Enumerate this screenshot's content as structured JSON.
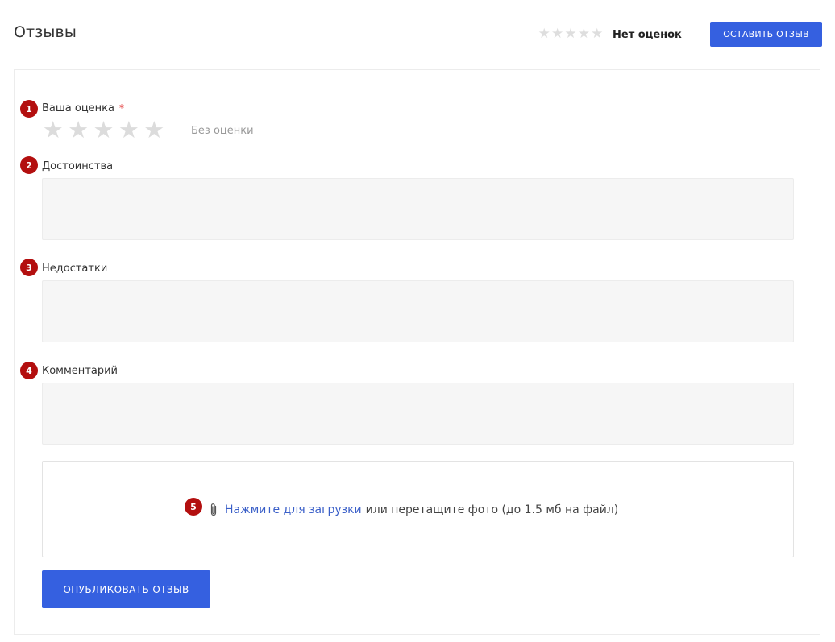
{
  "header": {
    "title": "Отзывы",
    "summary_stars": [
      "★",
      "★",
      "★",
      "★",
      "★"
    ],
    "summary_text": "Нет оценок",
    "leave_review_label": "ОСТАВИТЬ ОТЗЫВ"
  },
  "form": {
    "rating": {
      "badge": "1",
      "label": "Ваша оценка",
      "required_mark": "*",
      "stars": [
        "★",
        "★",
        "★",
        "★",
        "★"
      ],
      "value": 0,
      "max": 5,
      "dash": "—",
      "empty_text": "Без оценки"
    },
    "pros": {
      "badge": "2",
      "label": "Достоинства",
      "value": "",
      "placeholder": ""
    },
    "cons": {
      "badge": "3",
      "label": "Недостатки",
      "value": "",
      "placeholder": ""
    },
    "comment": {
      "badge": "4",
      "label": "Комментарий",
      "value": "",
      "placeholder": ""
    },
    "upload": {
      "badge": "5",
      "link_text": "Нажмите для загрузки",
      "rest_text": "или перетащите фото (до 1.5 мб на файл)"
    },
    "publish_label": "ОПУБЛИКОВАТЬ ОТЗЫВ"
  },
  "colors": {
    "accent": "#3560e0",
    "badge": "#b30f0f",
    "star_empty": "#dcdcdc",
    "link": "#3a5fc8",
    "field_bg": "#f6f6f6"
  },
  "icons": {
    "star": "star-icon",
    "attachment": "paperclip-icon"
  }
}
